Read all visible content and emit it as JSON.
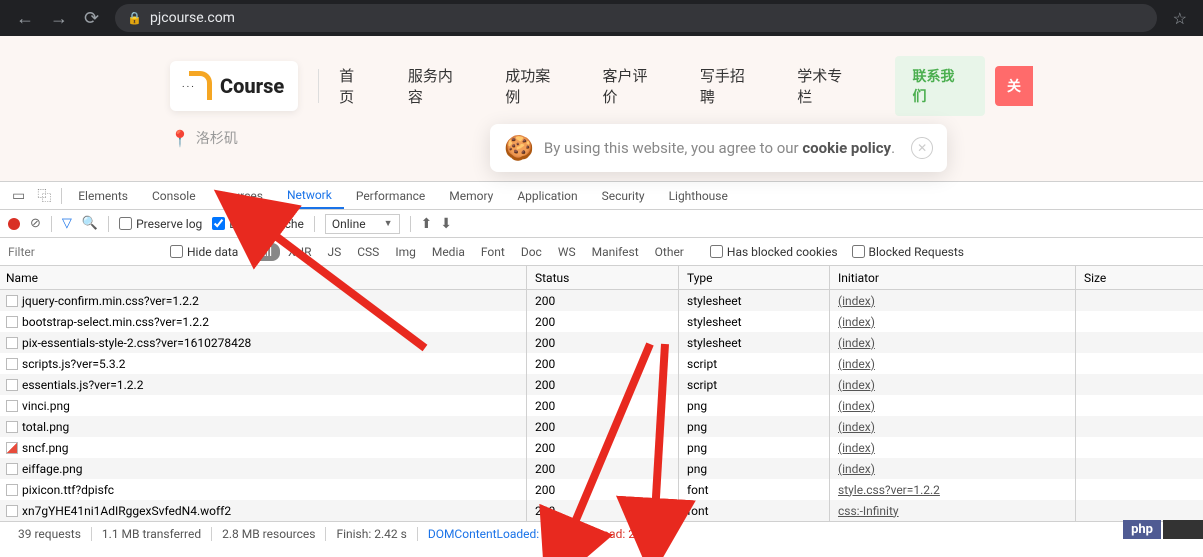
{
  "browser": {
    "url": "pjcourse.com"
  },
  "site": {
    "logo_text": "Course",
    "nav": [
      "首页",
      "服务内容",
      "成功案例",
      "客户评价",
      "写手招聘",
      "学术专栏"
    ],
    "contact": "联系我们",
    "about": "关",
    "location": "洛杉矶"
  },
  "cookie": {
    "prefix": "By using this website, you agree to our ",
    "link": "cookie policy"
  },
  "devtools": {
    "tabs": [
      "Elements",
      "Console",
      "Sources",
      "Network",
      "Performance",
      "Memory",
      "Application",
      "Security",
      "Lighthouse"
    ],
    "active_tab": "Network",
    "preserve_log": "Preserve log",
    "disable_cache": "Disable cache",
    "throttle": "Online",
    "filter_placeholder": "Filter",
    "hide_data": "Hide data",
    "type_filters": [
      "All",
      "XHR",
      "JS",
      "CSS",
      "Img",
      "Media",
      "Font",
      "Doc",
      "WS",
      "Manifest",
      "Other"
    ],
    "has_blocked": "Has blocked cookies",
    "blocked_req": "Blocked Requests",
    "columns": {
      "name": "Name",
      "status": "Status",
      "type": "Type",
      "initiator": "Initiator",
      "size": "Size"
    },
    "rows": [
      {
        "name": "jquery-confirm.min.css?ver=1.2.2",
        "status": "200",
        "type": "stylesheet",
        "initiator": "(index)",
        "icon": ""
      },
      {
        "name": "bootstrap-select.min.css?ver=1.2.2",
        "status": "200",
        "type": "stylesheet",
        "initiator": "(index)",
        "icon": ""
      },
      {
        "name": "pix-essentials-style-2.css?ver=1610278428",
        "status": "200",
        "type": "stylesheet",
        "initiator": "(index)",
        "icon": ""
      },
      {
        "name": "scripts.js?ver=5.3.2",
        "status": "200",
        "type": "script",
        "initiator": "(index)",
        "icon": ""
      },
      {
        "name": "essentials.js?ver=1.2.2",
        "status": "200",
        "type": "script",
        "initiator": "(index)",
        "icon": ""
      },
      {
        "name": "vinci.png",
        "status": "200",
        "type": "png",
        "initiator": "(index)",
        "icon": ""
      },
      {
        "name": "total.png",
        "status": "200",
        "type": "png",
        "initiator": "(index)",
        "icon": ""
      },
      {
        "name": "sncf.png",
        "status": "200",
        "type": "png",
        "initiator": "(index)",
        "icon": "img"
      },
      {
        "name": "eiffage.png",
        "status": "200",
        "type": "png",
        "initiator": "(index)",
        "icon": ""
      },
      {
        "name": "pixicon.ttf?dpisfc",
        "status": "200",
        "type": "font",
        "initiator": "style.css?ver=1.2.2",
        "icon": ""
      },
      {
        "name": "xn7gYHE41ni1AdIRggexSvfedN4.woff2",
        "status": "200",
        "type": "font",
        "initiator": "css:-Infinity",
        "icon": ""
      }
    ],
    "status_bar": {
      "requests": "39 requests",
      "transferred": "1.1 MB transferred",
      "resources": "2.8 MB resources",
      "finish": "Finish: 2.42 s",
      "dcl": "DOMContentLoaded: 1.98 s",
      "load": "Load: 2.40 s"
    }
  },
  "watermark": "php"
}
